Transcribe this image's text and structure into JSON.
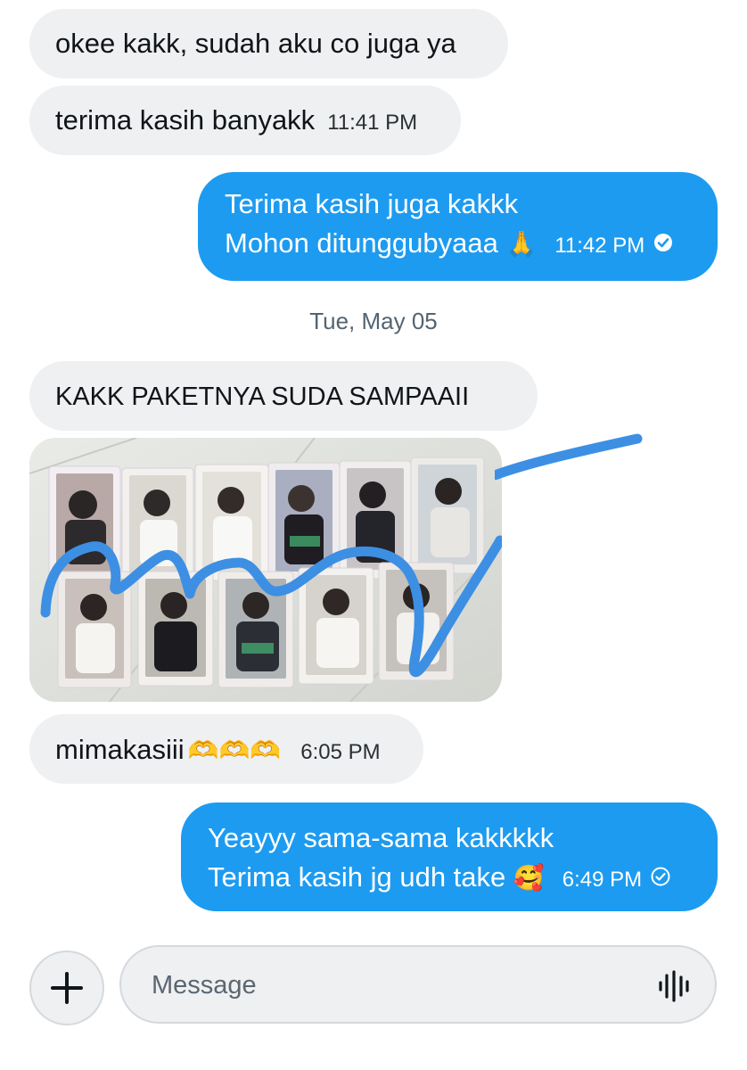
{
  "messages": [
    {
      "lines": [
        "okee kakk, sudah aku co juga ya"
      ],
      "time": ""
    },
    {
      "lines": [
        "terima kasih banyakk"
      ],
      "time": "11:41 PM"
    },
    {
      "lines": [
        "Terima kasih juga kakkk",
        "Mohon ditunggubyaaa"
      ],
      "emoji": "🙏",
      "time": "11:42 PM",
      "status": "read"
    },
    {
      "date_separator": "Tue, May 05"
    },
    {
      "lines": [
        "KAKK PAKETNYA SUDA SAMPAAII"
      ],
      "time": ""
    },
    {
      "image": "photo of photocards with blue scribble"
    },
    {
      "lines": [
        "mimakasiii"
      ],
      "emoji": "🫶🫶🫶",
      "time": "6:05 PM"
    },
    {
      "lines": [
        "Yeayyy sama-sama kakkkkk",
        "Terima kasih jg udh take"
      ],
      "emoji": "🥰",
      "time": "6:49 PM",
      "status": "sent"
    }
  ],
  "composer": {
    "placeholder": "Message"
  },
  "colors": {
    "sent_bubble": "#1d9bf0",
    "received_bubble": "#eef0f2",
    "scribble": "#3d8fe3"
  },
  "icons": {
    "add": "plus-icon",
    "voice": "voice-wave-icon",
    "read_status": "check-circle-filled-icon",
    "sent_status": "check-circle-outline-icon"
  }
}
